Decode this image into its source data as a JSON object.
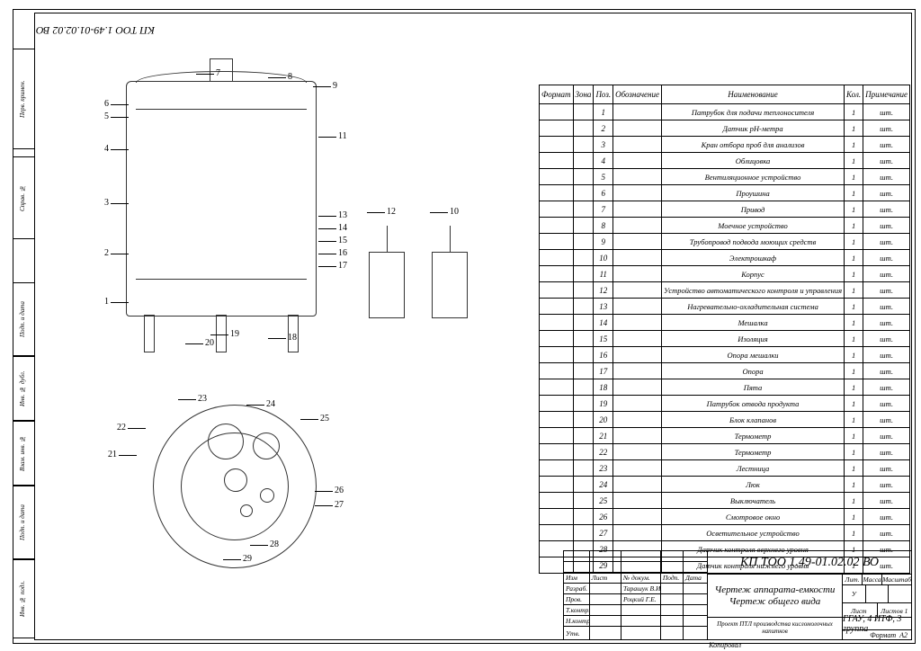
{
  "document_number": "КП ТОО 1.49-01.02.02 ВО",
  "document_number_mirrored": "КП ТОО 1.49-01.02.02 ВО",
  "parts_list": {
    "headers": {
      "format": "Формат",
      "zone": "Зона",
      "pos": "Поз.",
      "designation": "Обозначение",
      "name": "Наименование",
      "qty": "Кол.",
      "note": "Примечание"
    },
    "rows": [
      {
        "pos": "1",
        "name": "Патрубок для подачи теплоносителя",
        "qty": "1",
        "note": "шт."
      },
      {
        "pos": "2",
        "name": "Датчик рН-метра",
        "qty": "1",
        "note": "шт."
      },
      {
        "pos": "3",
        "name": "Кран отбора проб для анализов",
        "qty": "1",
        "note": "шт."
      },
      {
        "pos": "4",
        "name": "Облицовка",
        "qty": "1",
        "note": "шт."
      },
      {
        "pos": "5",
        "name": "Вентиляционное устройство",
        "qty": "1",
        "note": "шт."
      },
      {
        "pos": "6",
        "name": "Проушина",
        "qty": "1",
        "note": "шт."
      },
      {
        "pos": "7",
        "name": "Привод",
        "qty": "1",
        "note": "шт."
      },
      {
        "pos": "8",
        "name": "Моечное устройство",
        "qty": "1",
        "note": "шт."
      },
      {
        "pos": "9",
        "name": "Трубопровод подвода моющих средств",
        "qty": "1",
        "note": "шт."
      },
      {
        "pos": "10",
        "name": "Электрошкаф",
        "qty": "1",
        "note": "шт."
      },
      {
        "pos": "11",
        "name": "Корпус",
        "qty": "1",
        "note": "шт."
      },
      {
        "pos": "12",
        "name": "Устройство автоматического контроля и управления",
        "qty": "1",
        "note": "шт."
      },
      {
        "pos": "13",
        "name": "Нагревательно-охладительная система",
        "qty": "1",
        "note": "шт."
      },
      {
        "pos": "14",
        "name": "Мешалка",
        "qty": "1",
        "note": "шт."
      },
      {
        "pos": "15",
        "name": "Изоляция",
        "qty": "1",
        "note": "шт."
      },
      {
        "pos": "16",
        "name": "Опора мешалки",
        "qty": "1",
        "note": "шт."
      },
      {
        "pos": "17",
        "name": "Опора",
        "qty": "1",
        "note": "шт."
      },
      {
        "pos": "18",
        "name": "Пята",
        "qty": "1",
        "note": "шт."
      },
      {
        "pos": "19",
        "name": "Патрубок отвода продукта",
        "qty": "1",
        "note": "шт."
      },
      {
        "pos": "20",
        "name": "Блок клапанов",
        "qty": "1",
        "note": "шт."
      },
      {
        "pos": "21",
        "name": "Термометр",
        "qty": "1",
        "note": "шт."
      },
      {
        "pos": "22",
        "name": "Термометр",
        "qty": "1",
        "note": "шт."
      },
      {
        "pos": "23",
        "name": "Лестница",
        "qty": "1",
        "note": "шт."
      },
      {
        "pos": "24",
        "name": "Люк",
        "qty": "1",
        "note": "шт."
      },
      {
        "pos": "25",
        "name": "Выключатель",
        "qty": "1",
        "note": "шт."
      },
      {
        "pos": "26",
        "name": "Смотровое окно",
        "qty": "1",
        "note": "шт."
      },
      {
        "pos": "27",
        "name": "Осветительное устройство",
        "qty": "1",
        "note": "шт."
      },
      {
        "pos": "28",
        "name": "Датчик контроля верхнего уровня",
        "qty": "1",
        "note": "шт."
      },
      {
        "pos": "29",
        "name": "Датчик контроля нижнего уровня",
        "qty": "1",
        "note": "шт."
      }
    ]
  },
  "callouts_side": [
    "1",
    "2",
    "3",
    "4",
    "5",
    "6",
    "7",
    "8",
    "9",
    "10",
    "11",
    "12",
    "13",
    "14",
    "15",
    "16",
    "17",
    "18",
    "19",
    "20"
  ],
  "callouts_top": [
    "21",
    "22",
    "23",
    "24",
    "25",
    "26",
    "27",
    "28",
    "29"
  ],
  "title_block": {
    "header_row": {
      "c1": "Изм",
      "c2": "Лист",
      "c3": "№ докум.",
      "c4": "Подп.",
      "c5": "Дата"
    },
    "roles": [
      {
        "role": "Разраб.",
        "name": "Тарашук В.И."
      },
      {
        "role": "Пров.",
        "name": "Роцкий Г.Е."
      },
      {
        "role": "Т.контр.",
        "name": ""
      },
      {
        "role": "Н.контр.",
        "name": ""
      },
      {
        "role": "Утв.",
        "name": ""
      }
    ],
    "doc_number": "КП ТОО 1.49-01.02.02 ВО",
    "title_line1": "Чертеж аппарата-емкости",
    "title_line2": "Чертеж общего вида",
    "meta_headers": {
      "lit": "Лит.",
      "mass": "Масса",
      "scale": "Масштаб"
    },
    "meta_values": {
      "lit": "У",
      "mass": "",
      "scale": ""
    },
    "sheets": {
      "sheet_label": "Лист",
      "sheets_label": "Листов",
      "sheet": "",
      "sheets": "1"
    },
    "project": "Проект ПТЛ производства кисломолочных напитков",
    "org": "ГГАУ, 4 ИТФ, 3 группа",
    "format_label": "Формат",
    "format_value": "А2",
    "copied_by": "Копировал"
  },
  "left_strip_labels": [
    "Перв. примен.",
    "Справ. №",
    "Подп. и дата",
    "Инв. № дубл.",
    "Взам. инв. №",
    "Подп. и дата",
    "Инв. № подл."
  ]
}
